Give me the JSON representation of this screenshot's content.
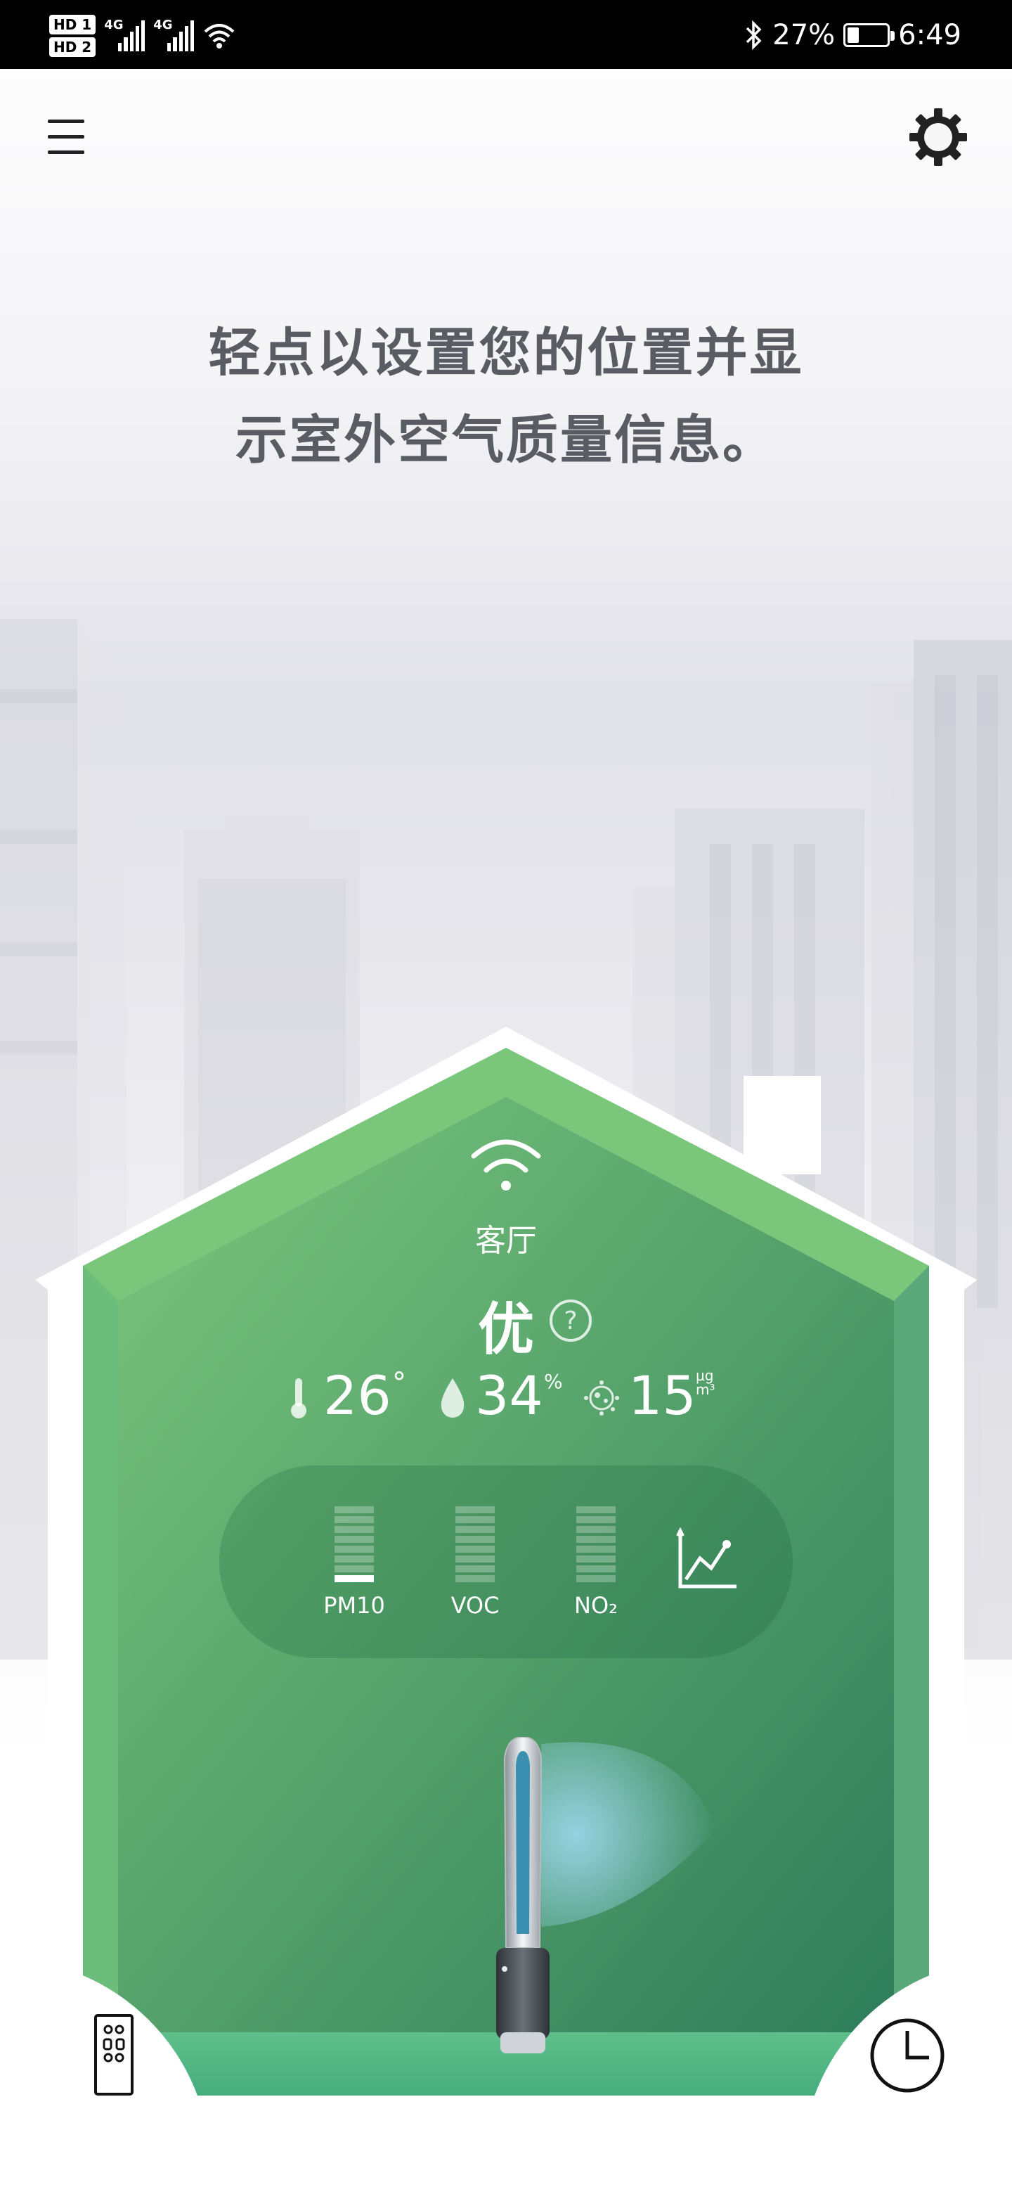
{
  "status_bar": {
    "network1": "4G",
    "network2": "4G",
    "hd1": "HD 1",
    "hd2": "HD 2",
    "battery": "27%",
    "time": "6:49"
  },
  "header": {
    "menu_icon": "hamburger-icon",
    "settings_icon": "gear-icon"
  },
  "prompt": {
    "line1": "轻点以设置您的位置并显",
    "line2": "示室外空气质量信息。"
  },
  "room": {
    "name": "客厅",
    "quality": "优",
    "temperature": "26",
    "temperature_unit": "°",
    "humidity": "34",
    "humidity_unit": "%",
    "pm": "15",
    "pm_unit_top": "μg",
    "pm_unit_bottom": "m³"
  },
  "pollutants": [
    {
      "label": "PM10",
      "level_bars": 1
    },
    {
      "label": "VOC",
      "level_bars": 0
    },
    {
      "label": "NO₂",
      "level_bars": 0
    }
  ],
  "colors": {
    "house_light": "#7cc77c",
    "house_dark": "#2e7d5b",
    "floor": "#4fb585"
  },
  "bottom": {
    "remote_icon": "remote-icon",
    "schedule_icon": "clock-icon"
  }
}
